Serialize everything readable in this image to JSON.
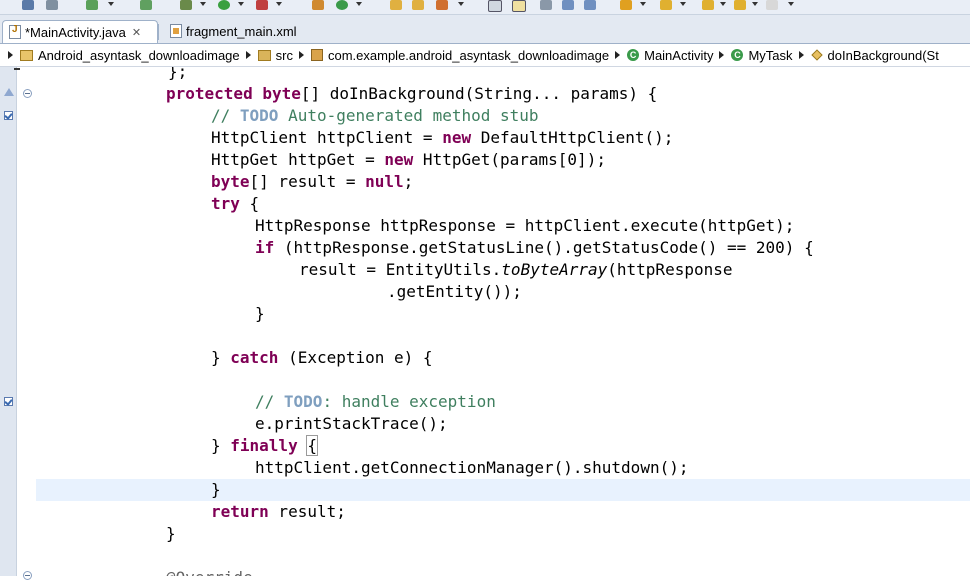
{
  "tabs": [
    {
      "label": "*MainActivity.java",
      "active": true,
      "icon": "java-file-icon"
    },
    {
      "label": "fragment_main.xml",
      "active": false,
      "icon": "xml-file-icon"
    }
  ],
  "breadcrumb": [
    {
      "label": "Android_asyntask_downloadimage",
      "icon": "project-icon"
    },
    {
      "label": "src",
      "icon": "source-folder-icon"
    },
    {
      "label": "com.example.android_asyntask_downloadimage",
      "icon": "package-icon"
    },
    {
      "label": "MainActivity",
      "icon": "class-icon"
    },
    {
      "label": "MyTask",
      "icon": "class-icon"
    },
    {
      "label": "doInBackground(St",
      "icon": "method-icon"
    }
  ],
  "code": {
    "l0": "};",
    "l1_kw1": "protected",
    "l1_kw2": "byte",
    "l1_rest": "[] doInBackground(String... params) {",
    "l2_cm1": "// ",
    "l2_todo": "TODO",
    "l2_cm2": " Auto-generated method stub",
    "l3_a": "HttpClient httpClient = ",
    "l3_kw": "new",
    "l3_b": " DefaultHttpClient();",
    "l4_a": "HttpGet httpGet = ",
    "l4_kw": "new",
    "l4_b": " HttpGet(params[0]);",
    "l5_kw1": "byte",
    "l5_a": "[] result = ",
    "l5_kw2": "null",
    "l5_b": ";",
    "l6_kw": "try",
    "l6_b": " {",
    "l7": "HttpResponse httpResponse = httpClient.execute(httpGet);",
    "l8_kw": "if",
    "l8_b": " (httpResponse.getStatusLine().getStatusCode() == 200) {",
    "l9_a": "result = EntityUtils.",
    "l9_it": "toByteArray",
    "l9_b": "(httpResponse",
    "l10": ".getEntity());",
    "l11": "}",
    "l13_a": "} ",
    "l13_kw": "catch",
    "l13_b": " (Exception e) {",
    "l15_cm1": "// ",
    "l15_todo": "TODO",
    "l15_cm2": ": handle exception",
    "l16": "e.printStackTrace();",
    "l17_a": "} ",
    "l17_kw": "finally",
    "l17_sp": " ",
    "l17_br": "{",
    "l18": "httpClient.getConnectionManager().shutdown();",
    "l19": "}",
    "l20_kw": "return",
    "l20_b": " result;",
    "l21": "}",
    "l23": "@Override"
  },
  "colors": {
    "keyword": "#7f0055",
    "comment": "#3f7f5f",
    "todo": "#7f9fbf",
    "current_line": "#e8f2fe"
  }
}
